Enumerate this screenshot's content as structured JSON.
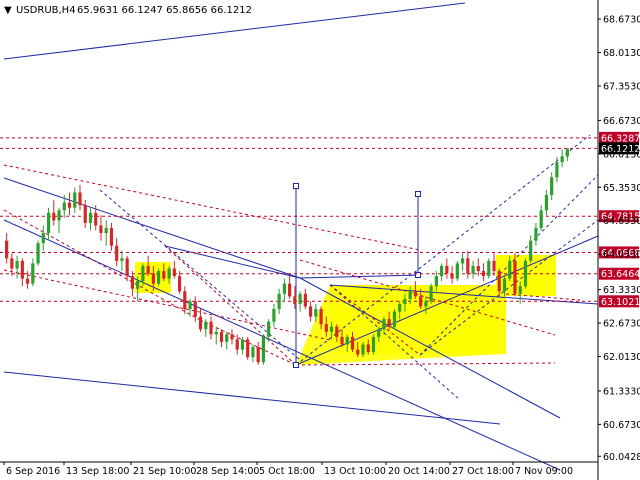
{
  "header": {
    "symbol": "USDRUB,H4",
    "ohlc": "65.9631 66.1247 65.8656 66.1212",
    "arrow_glyph": "▼"
  },
  "colors": {
    "background": "#ffffff",
    "bull_candle": "#2ca02c",
    "bear_candle": "#d62728",
    "trendline": "#1f2aa6",
    "level_line": "#c00026",
    "highlight": "#ffff00",
    "current_badge": "#000000",
    "marker": "#1f2aa6"
  },
  "chart_data": {
    "type": "candlestick",
    "title": "USDRUB,H4",
    "ylim": [
      59.93,
      69.05
    ],
    "y_ticks": [
      "68.6730",
      "68.0130",
      "67.3530",
      "66.6730",
      "66.0130",
      "65.3530",
      "64.6930",
      "64.0330",
      "63.3330",
      "62.6730",
      "62.0130",
      "61.3330",
      "60.6730",
      "60.0428"
    ],
    "x_ticks": [
      "6 Sep 2016",
      "13 Sep 18:00",
      "21 Sep 10:00",
      "28 Sep 14:00",
      "5 Oct 18:00",
      "13 Oct 10:00",
      "20 Oct 14:00",
      "27 Oct 18:00",
      "7 Nov 09:00"
    ],
    "bar_count": 108,
    "price_labels": [
      {
        "text": "66.3287",
        "value": 66.3287,
        "kind": "level"
      },
      {
        "text": "66.1212",
        "value": 66.1212,
        "kind": "current"
      },
      {
        "text": "64.7815",
        "value": 64.7815,
        "kind": "level"
      },
      {
        "text": "64.0668",
        "value": 64.0668,
        "kind": "level"
      },
      {
        "text": "63.6464",
        "value": 63.6464,
        "kind": "level"
      },
      {
        "text": "63.1021",
        "value": 63.1021,
        "kind": "level"
      }
    ],
    "horizontal_levels": [
      66.3287,
      66.1212,
      64.7815,
      64.0668,
      63.6464,
      63.1021
    ],
    "candles": [
      {
        "o": 64.3,
        "h": 64.45,
        "l": 63.85,
        "c": 63.95
      },
      {
        "o": 63.95,
        "h": 64.05,
        "l": 63.6,
        "c": 63.75
      },
      {
        "o": 63.75,
        "h": 64.0,
        "l": 63.55,
        "c": 63.9
      },
      {
        "o": 63.9,
        "h": 63.95,
        "l": 63.4,
        "c": 63.55
      },
      {
        "o": 63.55,
        "h": 63.7,
        "l": 63.35,
        "c": 63.45
      },
      {
        "o": 63.45,
        "h": 63.95,
        "l": 63.4,
        "c": 63.85
      },
      {
        "o": 63.85,
        "h": 64.3,
        "l": 63.8,
        "c": 64.25
      },
      {
        "o": 64.25,
        "h": 64.6,
        "l": 64.1,
        "c": 64.45
      },
      {
        "o": 64.45,
        "h": 64.95,
        "l": 64.3,
        "c": 64.85
      },
      {
        "o": 64.85,
        "h": 65.1,
        "l": 64.6,
        "c": 64.7
      },
      {
        "o": 64.7,
        "h": 64.95,
        "l": 64.45,
        "c": 64.9
      },
      {
        "o": 64.9,
        "h": 65.2,
        "l": 64.75,
        "c": 65.05
      },
      {
        "o": 65.05,
        "h": 65.25,
        "l": 64.8,
        "c": 64.95
      },
      {
        "o": 64.95,
        "h": 65.35,
        "l": 64.85,
        "c": 65.25
      },
      {
        "o": 65.25,
        "h": 65.4,
        "l": 64.9,
        "c": 65.0
      },
      {
        "o": 65.0,
        "h": 65.1,
        "l": 64.55,
        "c": 64.65
      },
      {
        "o": 64.65,
        "h": 64.95,
        "l": 64.5,
        "c": 64.85
      },
      {
        "o": 64.85,
        "h": 65.0,
        "l": 64.5,
        "c": 64.6
      },
      {
        "o": 64.6,
        "h": 64.8,
        "l": 64.3,
        "c": 64.45
      },
      {
        "o": 64.45,
        "h": 64.7,
        "l": 64.2,
        "c": 64.55
      },
      {
        "o": 64.55,
        "h": 64.65,
        "l": 64.1,
        "c": 64.2
      },
      {
        "o": 64.2,
        "h": 64.35,
        "l": 63.8,
        "c": 63.9
      },
      {
        "o": 63.9,
        "h": 64.1,
        "l": 63.7,
        "c": 63.95
      },
      {
        "o": 63.95,
        "h": 64.0,
        "l": 63.5,
        "c": 63.6
      },
      {
        "o": 63.6,
        "h": 63.7,
        "l": 63.2,
        "c": 63.35
      },
      {
        "o": 63.35,
        "h": 63.6,
        "l": 63.1,
        "c": 63.5
      },
      {
        "o": 63.5,
        "h": 63.85,
        "l": 63.4,
        "c": 63.8
      },
      {
        "o": 63.8,
        "h": 64.0,
        "l": 63.6,
        "c": 63.65
      },
      {
        "o": 63.65,
        "h": 63.8,
        "l": 63.3,
        "c": 63.45
      },
      {
        "o": 63.45,
        "h": 63.75,
        "l": 63.4,
        "c": 63.7
      },
      {
        "o": 63.7,
        "h": 63.85,
        "l": 63.5,
        "c": 63.55
      },
      {
        "o": 63.55,
        "h": 63.8,
        "l": 63.45,
        "c": 63.75
      },
      {
        "o": 63.75,
        "h": 63.9,
        "l": 63.55,
        "c": 63.6
      },
      {
        "o": 63.6,
        "h": 63.7,
        "l": 63.25,
        "c": 63.3
      },
      {
        "o": 63.3,
        "h": 63.4,
        "l": 62.85,
        "c": 62.95
      },
      {
        "o": 62.95,
        "h": 63.15,
        "l": 62.8,
        "c": 63.1
      },
      {
        "o": 63.1,
        "h": 63.2,
        "l": 62.7,
        "c": 62.8
      },
      {
        "o": 62.8,
        "h": 62.95,
        "l": 62.5,
        "c": 62.55
      },
      {
        "o": 62.55,
        "h": 62.75,
        "l": 62.4,
        "c": 62.7
      },
      {
        "o": 62.7,
        "h": 62.8,
        "l": 62.35,
        "c": 62.45
      },
      {
        "o": 62.45,
        "h": 62.6,
        "l": 62.25,
        "c": 62.5
      },
      {
        "o": 62.5,
        "h": 62.55,
        "l": 62.2,
        "c": 62.3
      },
      {
        "o": 62.3,
        "h": 62.5,
        "l": 62.15,
        "c": 62.45
      },
      {
        "o": 62.45,
        "h": 62.55,
        "l": 62.25,
        "c": 62.35
      },
      {
        "o": 62.35,
        "h": 62.45,
        "l": 62.05,
        "c": 62.15
      },
      {
        "o": 62.15,
        "h": 62.4,
        "l": 62.05,
        "c": 62.35
      },
      {
        "o": 62.35,
        "h": 62.4,
        "l": 61.95,
        "c": 62.0
      },
      {
        "o": 62.0,
        "h": 62.25,
        "l": 61.9,
        "c": 62.2
      },
      {
        "o": 62.2,
        "h": 62.3,
        "l": 61.85,
        "c": 61.9
      },
      {
        "o": 61.9,
        "h": 62.45,
        "l": 61.85,
        "c": 62.4
      },
      {
        "o": 62.4,
        "h": 62.75,
        "l": 62.3,
        "c": 62.7
      },
      {
        "o": 62.7,
        "h": 63.05,
        "l": 62.6,
        "c": 62.95
      },
      {
        "o": 62.95,
        "h": 63.35,
        "l": 62.85,
        "c": 63.25
      },
      {
        "o": 63.25,
        "h": 63.55,
        "l": 63.1,
        "c": 63.45
      },
      {
        "o": 63.45,
        "h": 63.6,
        "l": 63.15,
        "c": 63.2
      },
      {
        "o": 63.2,
        "h": 63.4,
        "l": 62.95,
        "c": 63.05
      },
      {
        "o": 63.05,
        "h": 63.3,
        "l": 62.9,
        "c": 63.25
      },
      {
        "o": 63.25,
        "h": 63.35,
        "l": 62.95,
        "c": 63.0
      },
      {
        "o": 63.0,
        "h": 63.1,
        "l": 62.7,
        "c": 62.8
      },
      {
        "o": 62.8,
        "h": 63.05,
        "l": 62.7,
        "c": 62.95
      },
      {
        "o": 62.95,
        "h": 63.0,
        "l": 62.55,
        "c": 62.65
      },
      {
        "o": 62.65,
        "h": 62.8,
        "l": 62.4,
        "c": 62.5
      },
      {
        "o": 62.5,
        "h": 62.7,
        "l": 62.35,
        "c": 62.6
      },
      {
        "o": 62.6,
        "h": 62.65,
        "l": 62.3,
        "c": 62.4
      },
      {
        "o": 62.4,
        "h": 62.55,
        "l": 62.2,
        "c": 62.25
      },
      {
        "o": 62.25,
        "h": 62.45,
        "l": 62.1,
        "c": 62.4
      },
      {
        "o": 62.4,
        "h": 62.5,
        "l": 62.1,
        "c": 62.15
      },
      {
        "o": 62.15,
        "h": 62.3,
        "l": 62.0,
        "c": 62.05
      },
      {
        "o": 62.05,
        "h": 62.3,
        "l": 62.0,
        "c": 62.25
      },
      {
        "o": 62.25,
        "h": 62.35,
        "l": 62.05,
        "c": 62.1
      },
      {
        "o": 62.1,
        "h": 62.45,
        "l": 62.05,
        "c": 62.4
      },
      {
        "o": 62.4,
        "h": 62.6,
        "l": 62.3,
        "c": 62.55
      },
      {
        "o": 62.55,
        "h": 62.8,
        "l": 62.45,
        "c": 62.75
      },
      {
        "o": 62.75,
        "h": 62.9,
        "l": 62.55,
        "c": 62.6
      },
      {
        "o": 62.6,
        "h": 62.95,
        "l": 62.55,
        "c": 62.9
      },
      {
        "o": 62.9,
        "h": 63.1,
        "l": 62.75,
        "c": 63.05
      },
      {
        "o": 63.05,
        "h": 63.25,
        "l": 62.9,
        "c": 63.15
      },
      {
        "o": 63.15,
        "h": 63.4,
        "l": 63.05,
        "c": 63.3
      },
      {
        "o": 63.3,
        "h": 63.5,
        "l": 63.15,
        "c": 63.2
      },
      {
        "o": 63.2,
        "h": 63.35,
        "l": 62.95,
        "c": 63.0
      },
      {
        "o": 63.0,
        "h": 63.2,
        "l": 62.85,
        "c": 63.1
      },
      {
        "o": 63.1,
        "h": 63.45,
        "l": 63.05,
        "c": 63.4
      },
      {
        "o": 63.4,
        "h": 63.7,
        "l": 63.3,
        "c": 63.6
      },
      {
        "o": 63.6,
        "h": 63.85,
        "l": 63.5,
        "c": 63.8
      },
      {
        "o": 63.8,
        "h": 63.95,
        "l": 63.55,
        "c": 63.65
      },
      {
        "o": 63.65,
        "h": 63.8,
        "l": 63.45,
        "c": 63.55
      },
      {
        "o": 63.55,
        "h": 63.9,
        "l": 63.5,
        "c": 63.85
      },
      {
        "o": 63.85,
        "h": 64.05,
        "l": 63.7,
        "c": 63.95
      },
      {
        "o": 63.95,
        "h": 64.1,
        "l": 63.55,
        "c": 63.65
      },
      {
        "o": 63.65,
        "h": 63.9,
        "l": 63.55,
        "c": 63.8
      },
      {
        "o": 63.8,
        "h": 63.95,
        "l": 63.6,
        "c": 63.7
      },
      {
        "o": 63.7,
        "h": 63.85,
        "l": 63.5,
        "c": 63.6
      },
      {
        "o": 63.6,
        "h": 63.95,
        "l": 63.55,
        "c": 63.9
      },
      {
        "o": 63.9,
        "h": 64.05,
        "l": 63.6,
        "c": 63.7
      },
      {
        "o": 63.7,
        "h": 63.75,
        "l": 63.2,
        "c": 63.3
      },
      {
        "o": 63.3,
        "h": 63.6,
        "l": 63.2,
        "c": 63.55
      },
      {
        "o": 63.55,
        "h": 64.0,
        "l": 63.5,
        "c": 63.9
      },
      {
        "o": 63.9,
        "h": 64.05,
        "l": 63.2,
        "c": 63.25
      },
      {
        "o": 63.25,
        "h": 63.5,
        "l": 63.05,
        "c": 63.4
      },
      {
        "o": 63.4,
        "h": 63.95,
        "l": 63.35,
        "c": 63.9
      },
      {
        "o": 63.9,
        "h": 64.4,
        "l": 63.85,
        "c": 64.3
      },
      {
        "o": 64.3,
        "h": 64.65,
        "l": 64.2,
        "c": 64.55
      },
      {
        "o": 64.55,
        "h": 65.0,
        "l": 64.5,
        "c": 64.9
      },
      {
        "o": 64.9,
        "h": 65.3,
        "l": 64.8,
        "c": 65.2
      },
      {
        "o": 65.2,
        "h": 65.65,
        "l": 65.1,
        "c": 65.55
      },
      {
        "o": 65.55,
        "h": 65.95,
        "l": 65.45,
        "c": 65.85
      },
      {
        "o": 65.85,
        "h": 66.1,
        "l": 65.75,
        "c": 65.96
      },
      {
        "o": 65.96,
        "h": 66.12,
        "l": 65.87,
        "c": 66.12
      }
    ]
  }
}
